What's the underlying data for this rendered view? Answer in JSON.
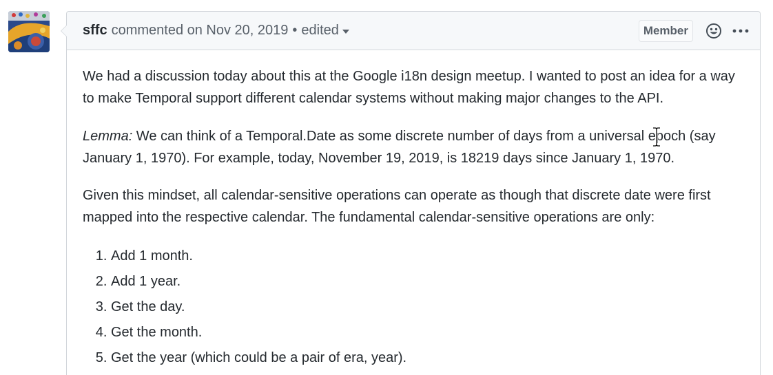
{
  "comment": {
    "author": "sffc",
    "action": "commented on Nov 20, 2019",
    "separator": "•",
    "edited_label": "edited",
    "badge": "Member",
    "icons": {
      "avatar": "user-avatar",
      "reaction": "smiley-icon",
      "more": "kebab-horizontal-icon",
      "edited_caret": "triangle-down-icon"
    },
    "body": {
      "p1": "We had a discussion today about this at the Google i18n design meetup. I wanted to post an idea for a way to make Temporal support different calendar systems without making major changes to the API.",
      "p2_lemma": "Lemma:",
      "p2_text": " We can think of a Temporal.Date as some discrete number of days from a universal epoch (say January 1, 1970). For example, today, November 19, 2019, is 18219 days since January 1, 1970.",
      "p3": "Given this mindset, all calendar-sensitive operations can operate as though that discrete date were first mapped into the respective calendar. The fundamental calendar-sensitive operations are only:",
      "list": [
        "Add 1 month.",
        "Add 1 year.",
        "Get the day.",
        "Get the month.",
        "Get the year (which could be a pair of era, year)."
      ]
    }
  },
  "colors": {
    "header_bg": "#f6f8fa",
    "border": "#d1d5da",
    "muted_text": "#586069",
    "text": "#24292e"
  }
}
